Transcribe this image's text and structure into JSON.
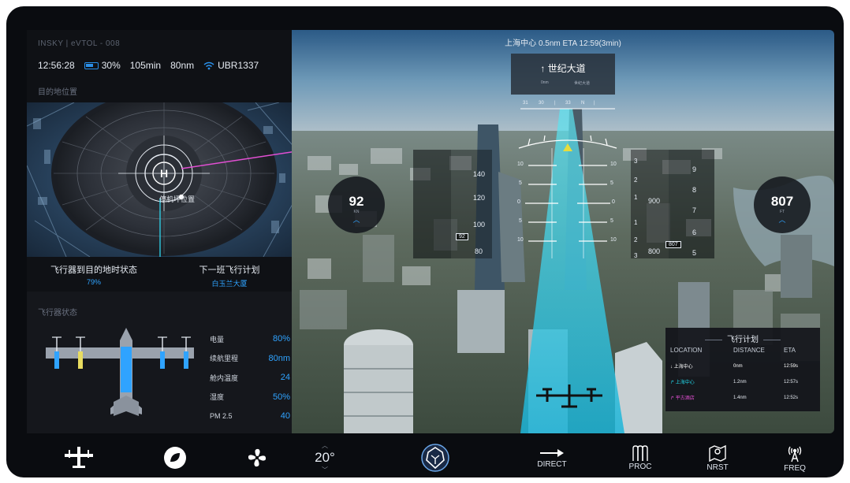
{
  "header": {
    "aircraft_id": "INSKY | eVTOL - 008",
    "time": "12:56:28",
    "battery": "30%",
    "endurance": "105min",
    "range": "80nm",
    "wifi_id": "UBR1337"
  },
  "destination": {
    "section_label": "目的地位置",
    "pad_label": "停机坪位置",
    "pad_letter": "H",
    "arrival_status_label": "飞行器到目的地时状态",
    "arrival_status_value": "79%",
    "next_plan_label": "下一班飞行计划",
    "next_plan_value": "白玉兰大厦"
  },
  "aircraft_status": {
    "section_label": "飞行器状态",
    "rows": [
      {
        "label": "电量",
        "value": "80%"
      },
      {
        "label": "续航里程",
        "value": "80nm"
      },
      {
        "label": "舱内温度",
        "value": "24"
      },
      {
        "label": "湿度",
        "value": "50%"
      },
      {
        "label": "PM 2.5",
        "value": "40"
      }
    ]
  },
  "hud": {
    "top_status": "上海中心 0.5nm ETA 12:59(3min)",
    "road_name": "世纪大道",
    "road_sub_left": "0nm",
    "road_sub_right": "世纪大道",
    "heading_ticks": [
      "31",
      "30",
      "|",
      "33",
      "N",
      "|"
    ],
    "speed": {
      "value": "92",
      "unit": "KN"
    },
    "altitude": {
      "value": "807",
      "unit": "FT"
    },
    "speed_tape": [
      "140",
      "120",
      "100",
      "80"
    ],
    "speed_marker": "92",
    "alt_tape_left": [
      "900",
      "800"
    ],
    "alt_tape_right": [
      "9",
      "8",
      "7",
      "6",
      "5"
    ],
    "alt_marker": "807",
    "pitch_left": [
      "10",
      "5",
      "0",
      "5",
      "10"
    ],
    "pitch_right": [
      "10",
      "5",
      "0",
      "5",
      "10"
    ],
    "vs_left": [
      "3",
      "2",
      "1",
      "1",
      "2",
      "3"
    ]
  },
  "flight_plan": {
    "title": "飞行计划",
    "headers": [
      "LOCATION",
      "DISTANCE",
      "ETA"
    ],
    "rows": [
      {
        "icon": "↓",
        "location": "上海中心",
        "distance": "0nm",
        "eta": "12:59s",
        "color": "#ffffff"
      },
      {
        "icon": "↱",
        "location": "上海中心",
        "distance": "1.2nm",
        "eta": "12:57s",
        "color": "#21d6e8"
      },
      {
        "icon": "↱",
        "location": "平古酒店",
        "distance": "1.4nm",
        "eta": "12:52s",
        "color": "#e24fd3"
      }
    ]
  },
  "bottom_bar": {
    "temp": "20°",
    "direct_label": "DIRECT",
    "proc_label": "PROC",
    "nrst_label": "NRST",
    "freq_label": "FREQ"
  },
  "colors": {
    "accent_blue": "#2fa3ff",
    "cyan_beam": "#2ec9e0",
    "magenta_route": "#e24fd3"
  }
}
